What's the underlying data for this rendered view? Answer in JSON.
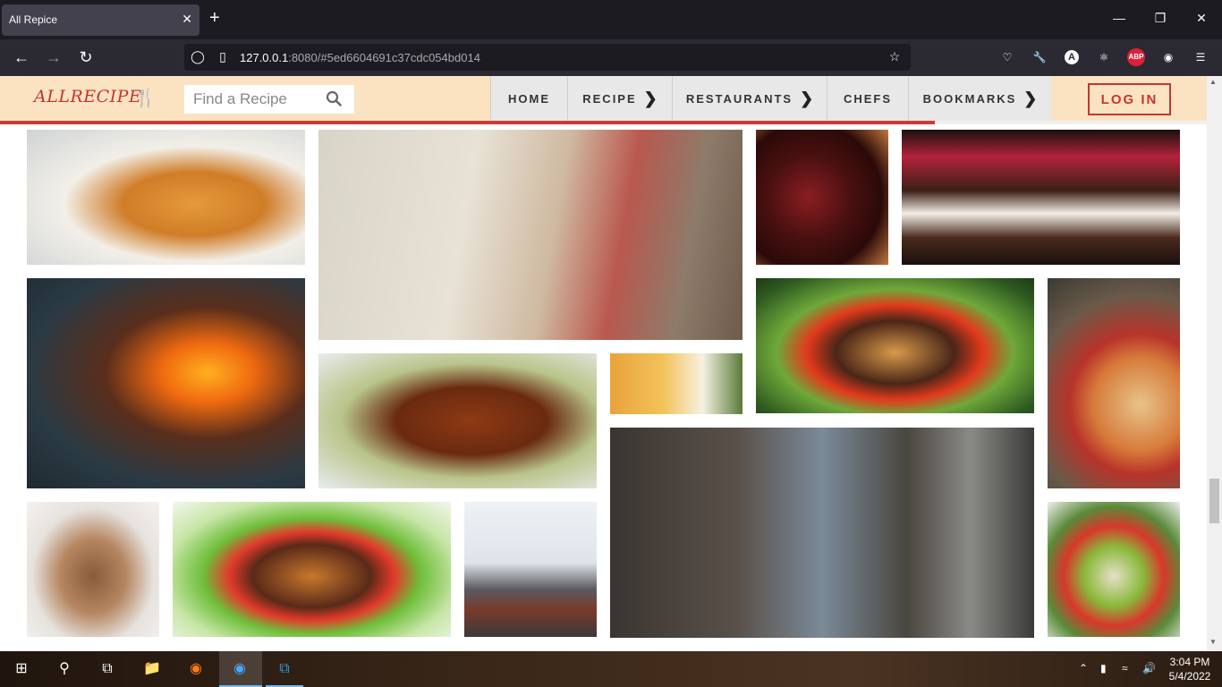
{
  "browser": {
    "tab_title": "All Repice",
    "tab_close": "✕",
    "new_tab": "+",
    "url_host": "127.0.0.1",
    "url_rest": ":8080/#5ed6604691c37cdc054bd014",
    "account_initial": "A",
    "abp_label": "ABP"
  },
  "site": {
    "logo": "ALLRECIPE",
    "search_placeholder": "Find a Recipe",
    "menu": [
      {
        "label": "HOME",
        "has_chevron": false
      },
      {
        "label": "RECIPE",
        "has_chevron": true
      },
      {
        "label": "RESTAURANTS",
        "has_chevron": true
      },
      {
        "label": "CHEFS",
        "has_chevron": false
      },
      {
        "label": "BOOKMARKS",
        "has_chevron": true
      }
    ],
    "chevron": "❯",
    "login_label": "LOG IN",
    "accent": "#c9342e",
    "header_bg": "#fbe3c2"
  },
  "gallery": [
    {
      "subject": "spaghetti-plate"
    },
    {
      "subject": "woman-cooking"
    },
    {
      "subject": "wine-glasses"
    },
    {
      "subject": "berry-chocolate-cake"
    },
    {
      "subject": "grill-flames"
    },
    {
      "subject": "glazed-chicken"
    },
    {
      "subject": "fries-and-dip"
    },
    {
      "subject": "burger-with-beer"
    },
    {
      "subject": "pizza"
    },
    {
      "subject": "chef-in-kitchen"
    },
    {
      "subject": "chocolate-drip-cake"
    },
    {
      "subject": "burger"
    },
    {
      "subject": "catering-event"
    },
    {
      "subject": "salad"
    }
  ],
  "taskbar": {
    "time": "3:04 PM",
    "date": "5/4/2022"
  }
}
